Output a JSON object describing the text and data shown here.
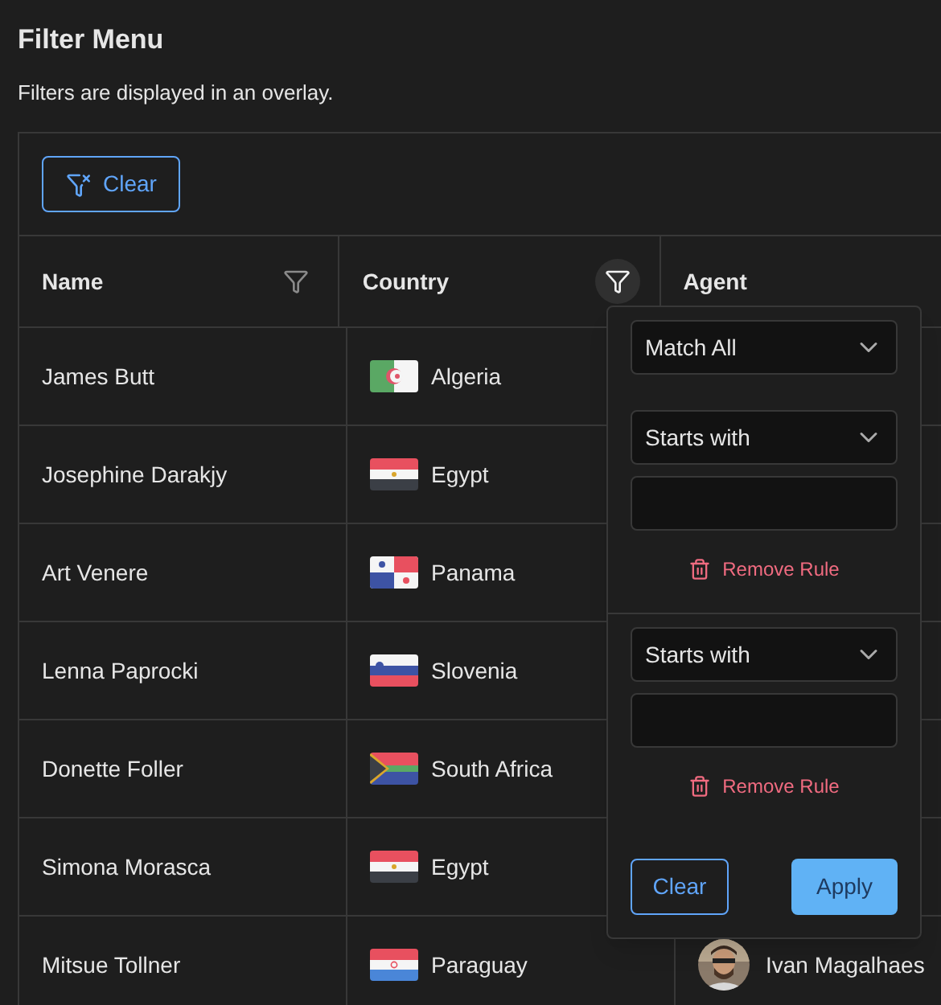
{
  "title": "Filter Menu",
  "subtitle": "Filters are displayed in an overlay.",
  "toolbar": {
    "clear_button": "Clear"
  },
  "columns": [
    {
      "label": "Name",
      "filter": true,
      "filter_active": false
    },
    {
      "label": "Country",
      "filter": true,
      "filter_active": true
    },
    {
      "label": "Agent"
    }
  ],
  "rows": [
    {
      "name": "James Butt",
      "country": "Algeria",
      "kind": "dz"
    },
    {
      "name": "Josephine Darakjy",
      "country": "Egypt",
      "kind": "eg"
    },
    {
      "name": "Art Venere",
      "country": "Panama",
      "kind": "pa"
    },
    {
      "name": "Lenna Paprocki",
      "country": "Slovenia",
      "kind": "si"
    },
    {
      "name": "Donette Foller",
      "country": "South Africa",
      "kind": "za"
    },
    {
      "name": "Simona Morasca",
      "country": "Egypt",
      "kind": "eg"
    },
    {
      "name": "Mitsue Tollner",
      "country": "Paraguay",
      "kind": "py",
      "agent": {
        "name": "Ivan Magalhaes"
      }
    }
  ],
  "overlay": {
    "operator": "Match All",
    "rules": [
      {
        "match_mode": "Starts with",
        "remove_label": "Remove Rule"
      },
      {
        "match_mode": "Starts with",
        "remove_label": "Remove Rule"
      }
    ],
    "clear_button": "Clear",
    "apply_button": "Apply"
  }
}
